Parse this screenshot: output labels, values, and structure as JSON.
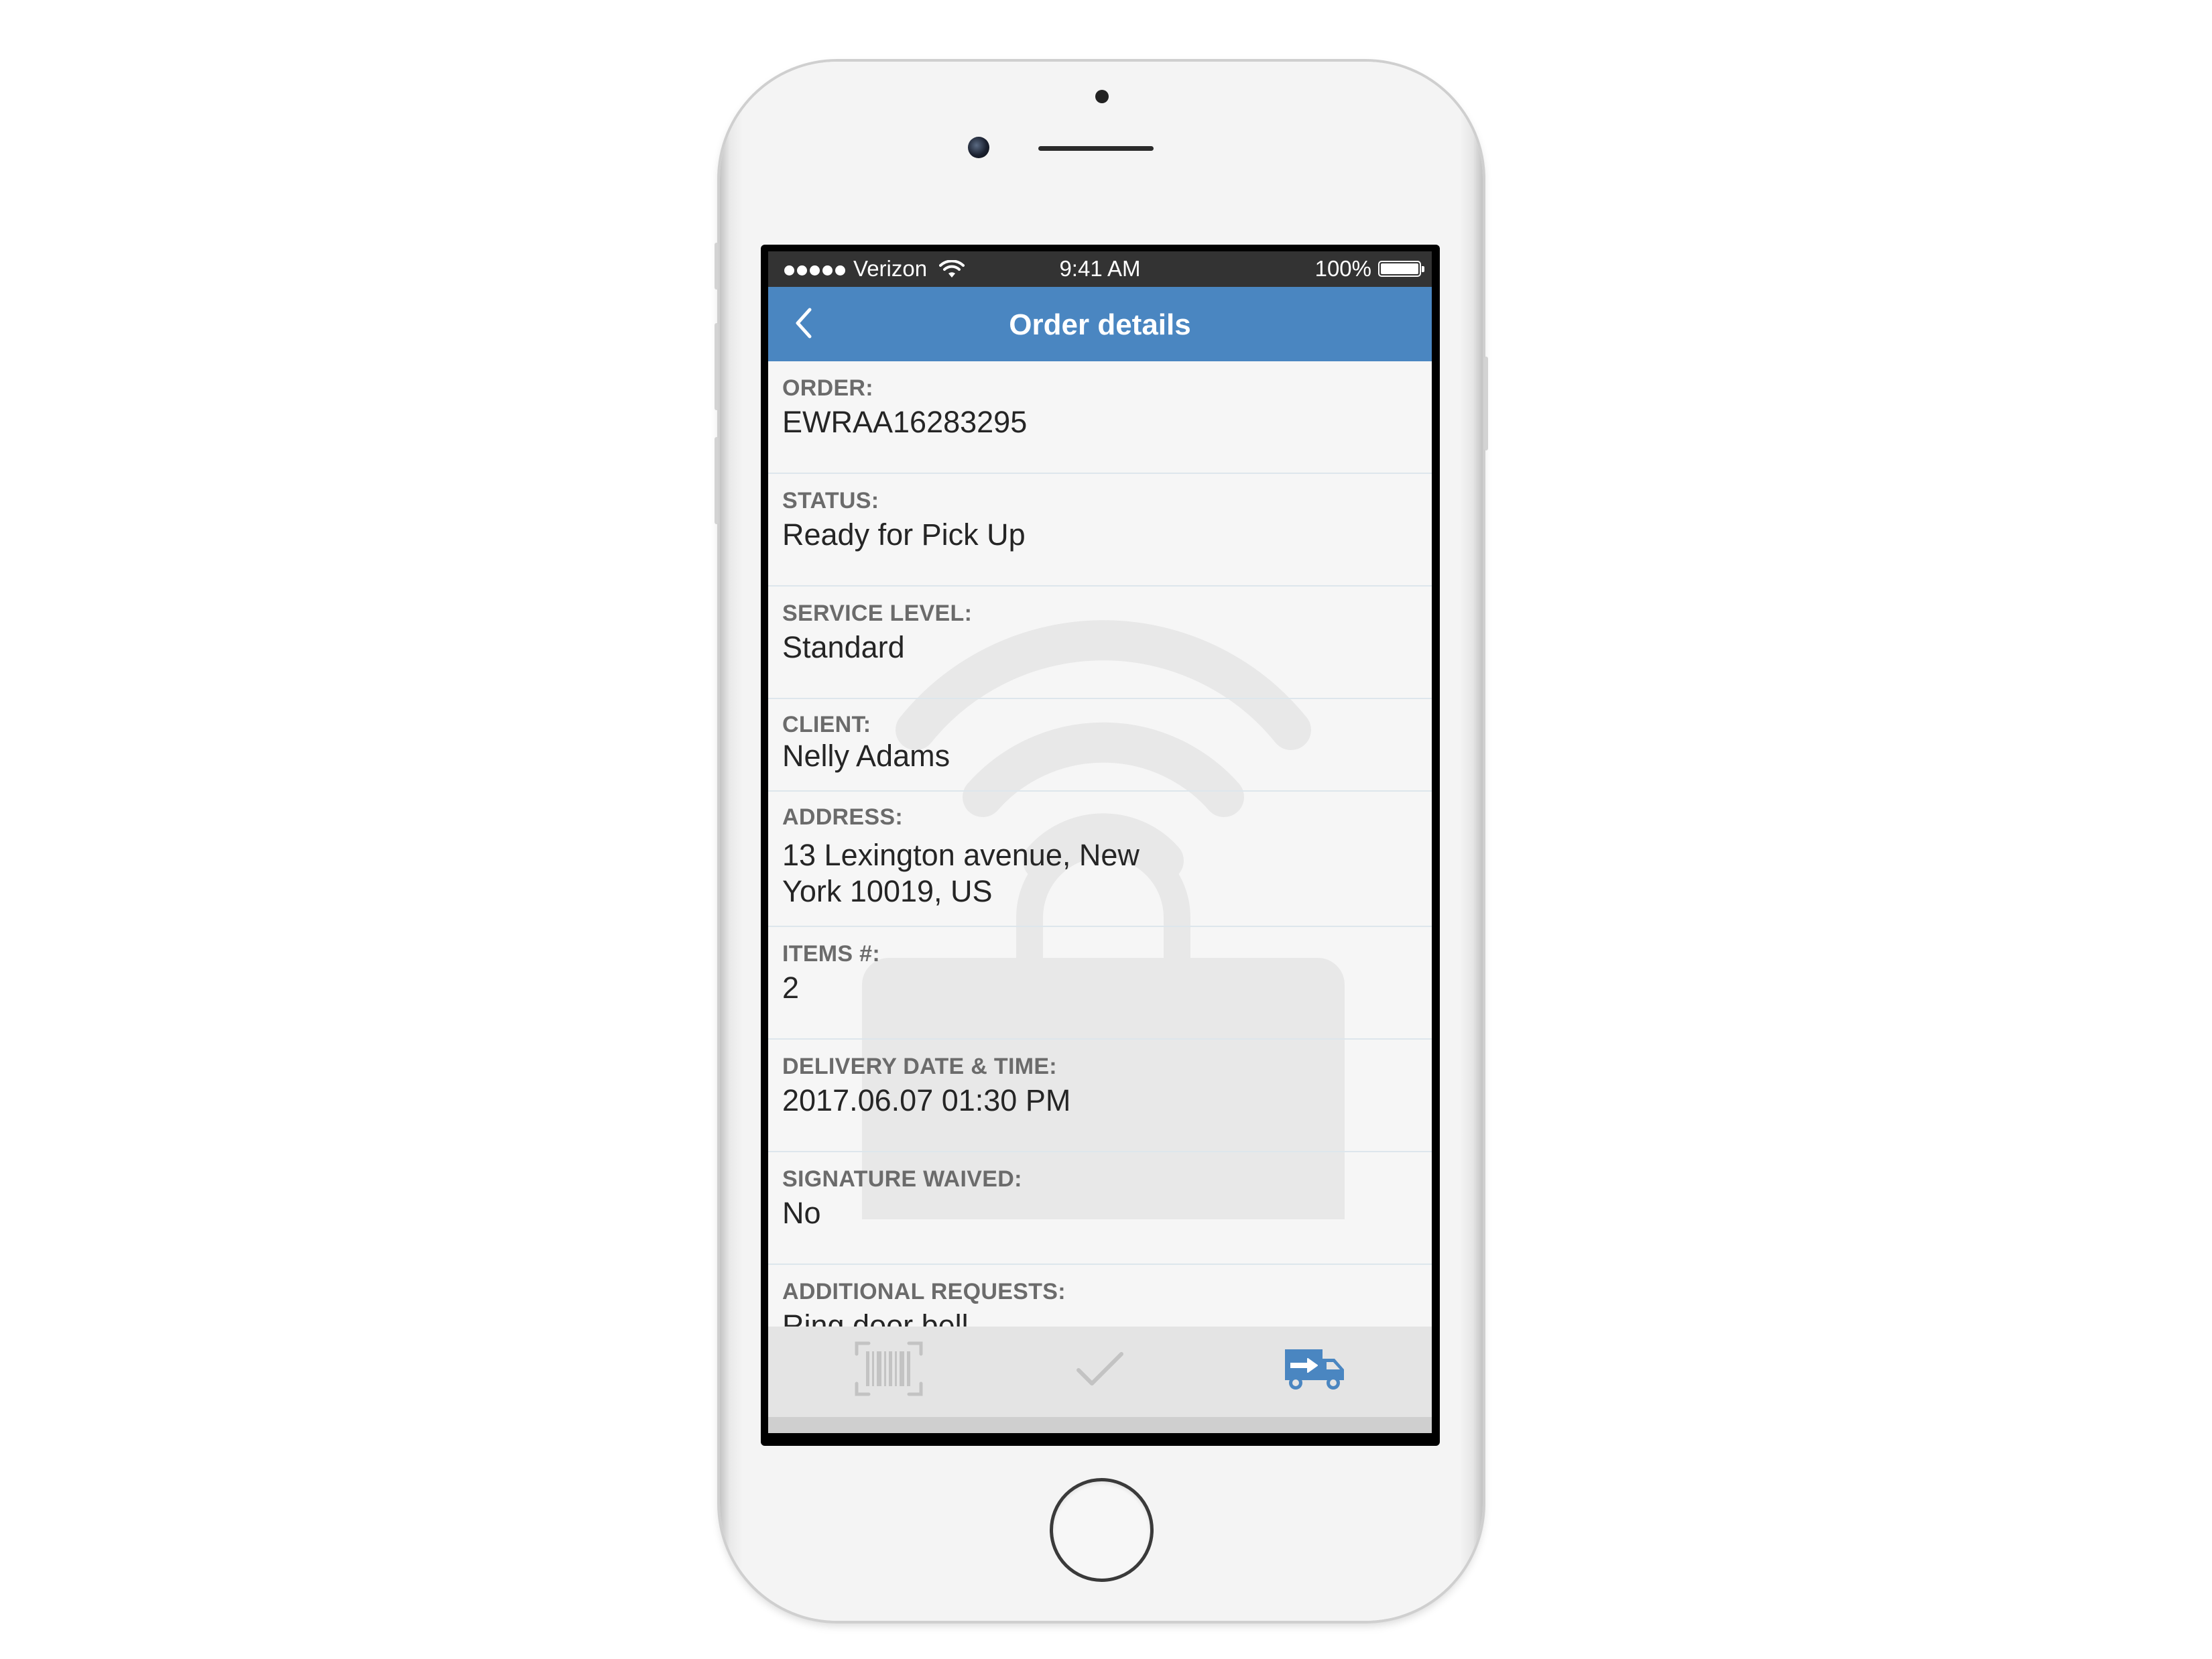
{
  "status_bar": {
    "carrier": "Verizon",
    "time": "9:41 AM",
    "battery": "100%"
  },
  "nav": {
    "title": "Order details",
    "back_icon": "chevron-left-icon"
  },
  "fields": [
    {
      "label": "ORDER:",
      "value": "EWRAA16283295"
    },
    {
      "label": "STATUS:",
      "value": "Ready for Pick Up"
    },
    {
      "label": "SERVICE LEVEL:",
      "value": "Standard"
    },
    {
      "label": "CLIENT:",
      "value": "Nelly Adams"
    },
    {
      "label": "ADDRESS:",
      "value_line1": "13 Lexington avenue, New",
      "value_line2": "York 10019, US"
    },
    {
      "label": "ITEMS #:",
      "value": "2"
    },
    {
      "label": "DELIVERY DATE & TIME:",
      "value": "2017.06.07 01:30 PM"
    },
    {
      "label": "SIGNATURE WAIVED:",
      "value": "No"
    },
    {
      "label": "ADDITIONAL REQUESTS:",
      "value": "Ring door bell"
    }
  ],
  "toolbar": {
    "items": [
      {
        "icon": "barcode-scan-icon",
        "active": false
      },
      {
        "icon": "checkmark-icon",
        "active": false
      },
      {
        "icon": "delivery-truck-icon",
        "active": true
      }
    ]
  },
  "colors": {
    "accent": "#4a86c1",
    "status_bar": "#333333",
    "label": "#6b6b6b",
    "value": "#252525",
    "toolbar_bg": "#e4e4e4",
    "inactive_icon": "#c3c3c3"
  }
}
